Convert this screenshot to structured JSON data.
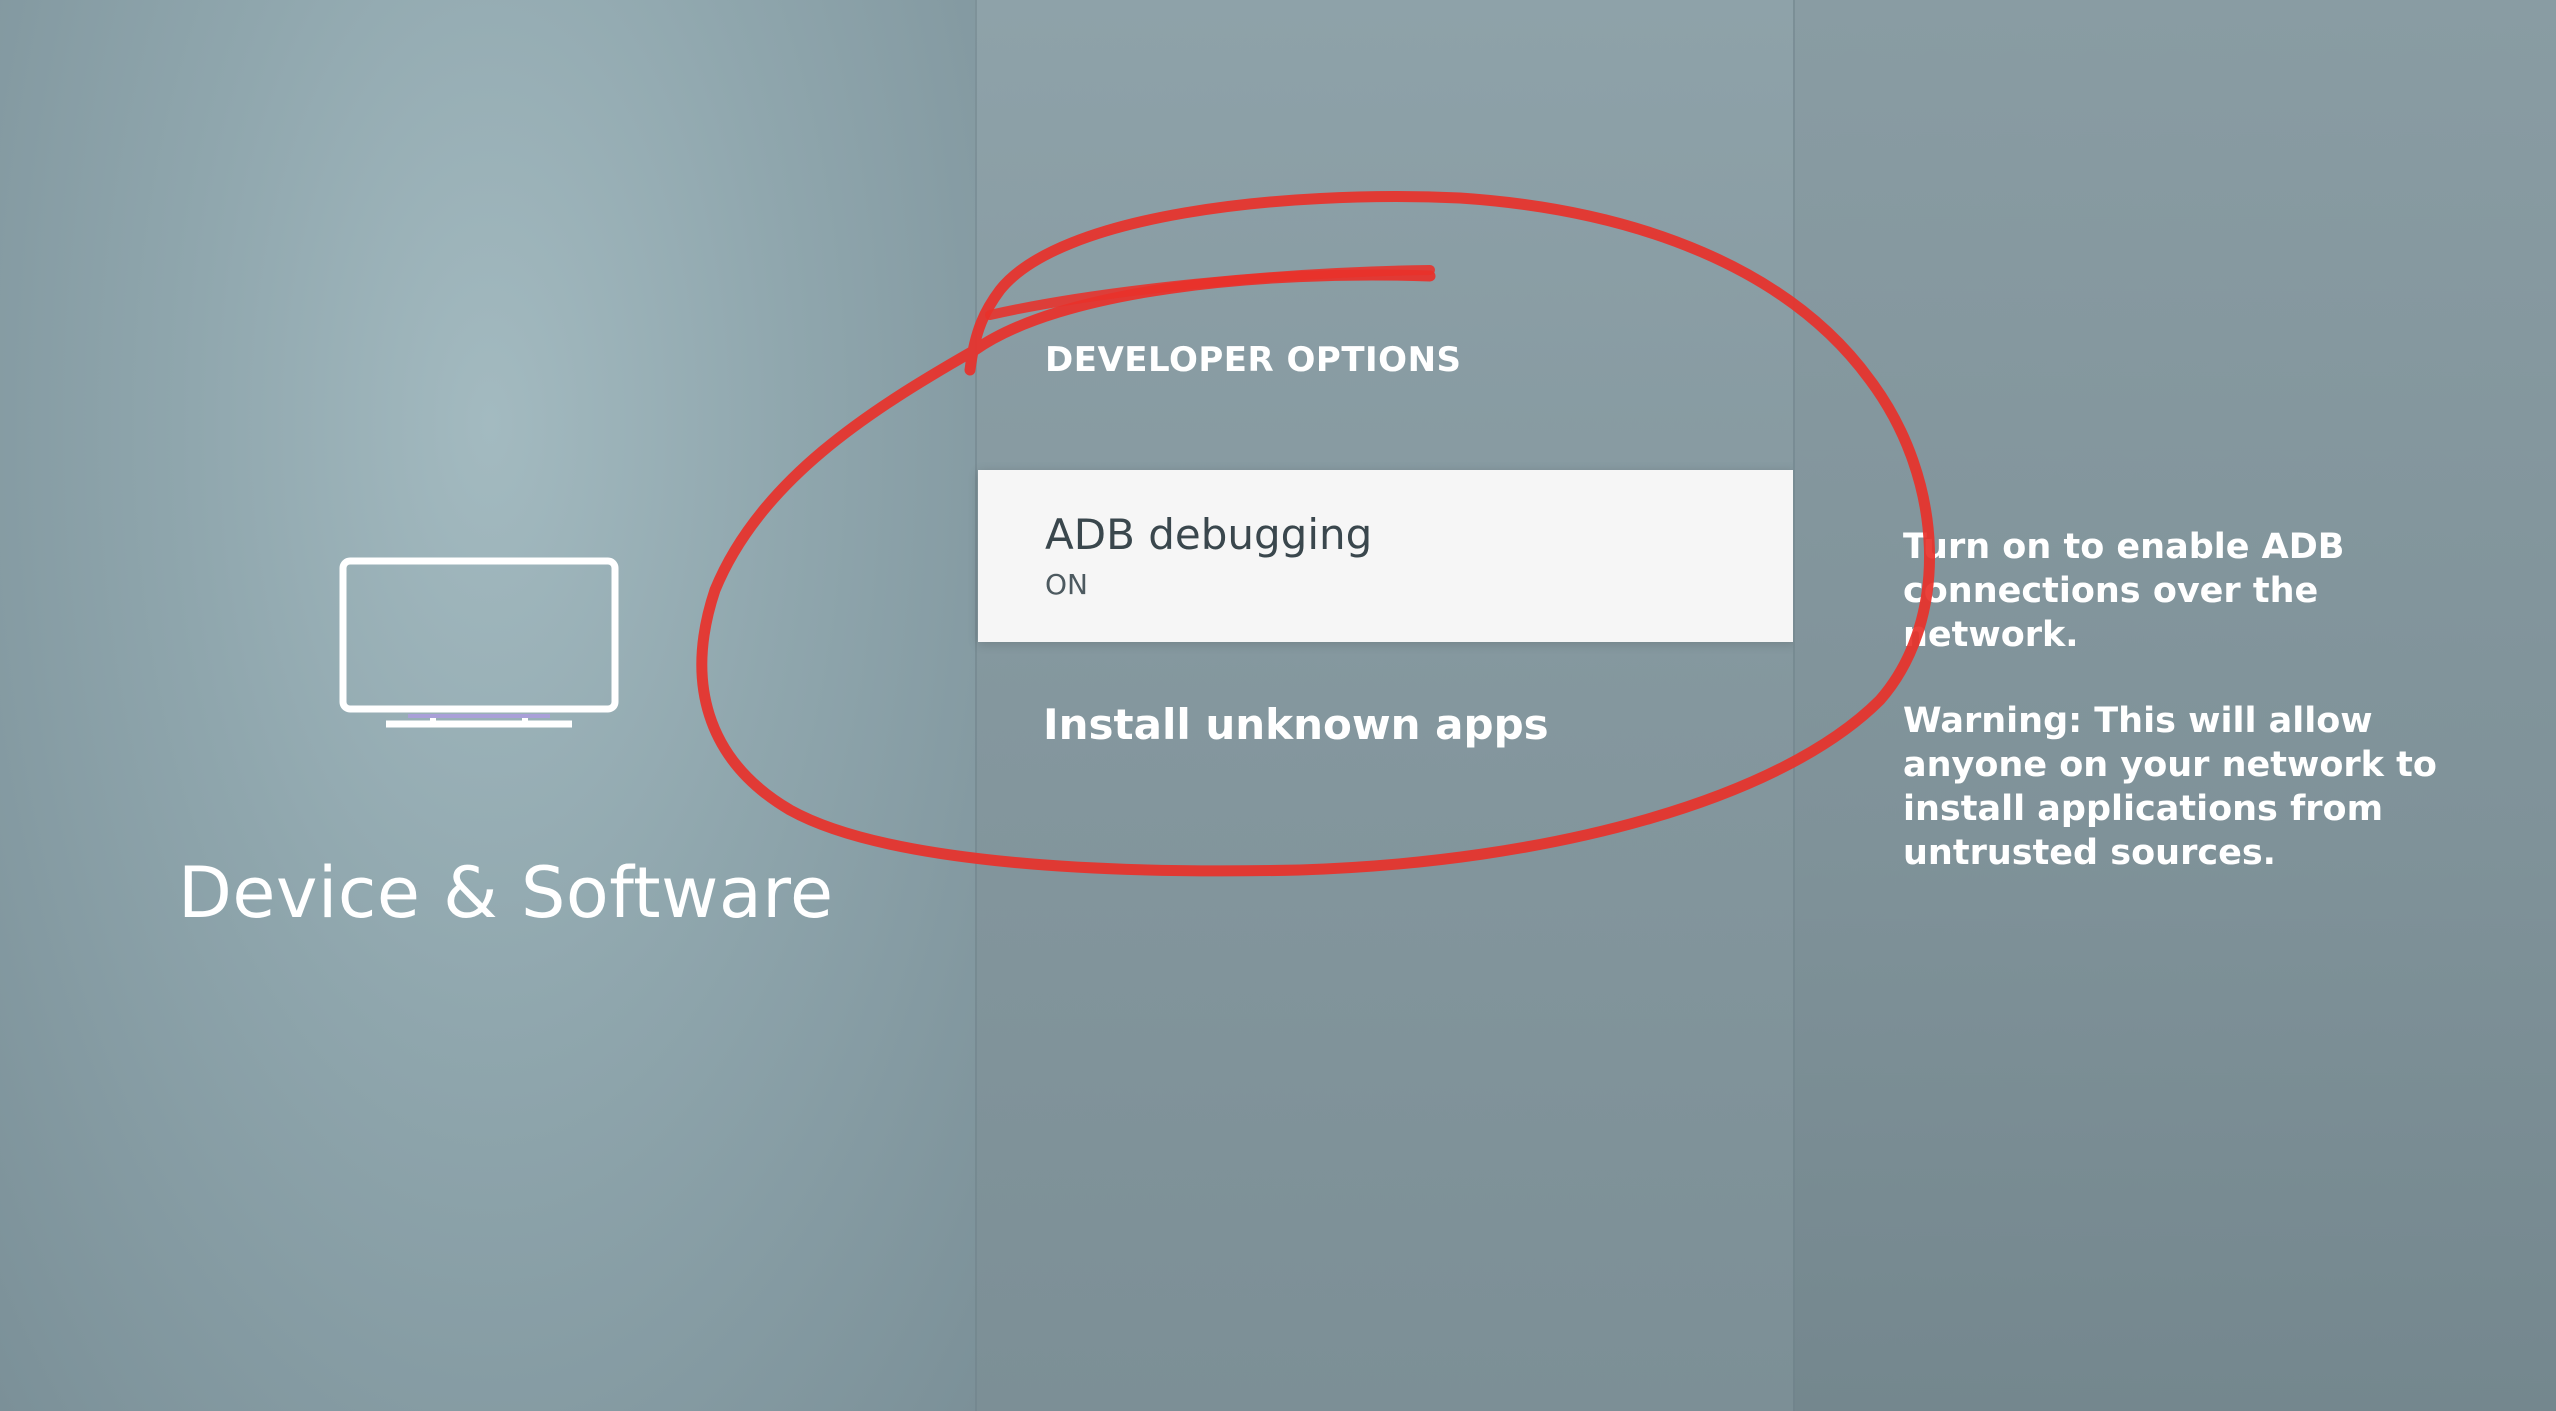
{
  "left_panel": {
    "category_title": "Device & Software",
    "icon": "tv-icon"
  },
  "middle_panel": {
    "section_header": "DEVELOPER OPTIONS",
    "items": [
      {
        "label": "ADB debugging",
        "value": "ON",
        "selected": true
      },
      {
        "label": "Install unknown apps",
        "value": "",
        "selected": false
      }
    ]
  },
  "right_panel": {
    "description_line1": "Turn on to enable ADB connections over the network.",
    "description_line2": "Warning: This will allow anyone on your network to install applications from untrusted sources."
  },
  "annotation": {
    "shape": "hand-drawn-circle",
    "color": "#e8312a"
  },
  "colors": {
    "selected_bg": "#f6f6f6",
    "selected_text": "#3a474d",
    "text_light": "#ffffff"
  }
}
